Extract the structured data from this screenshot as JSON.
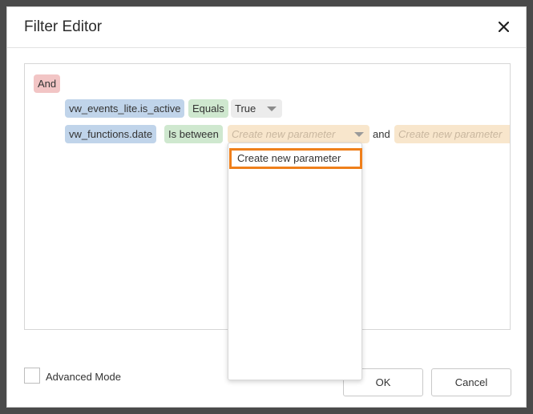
{
  "dialog": {
    "title": "Filter Editor",
    "close_icon": "close-icon"
  },
  "filter": {
    "group": "And",
    "conditions": [
      {
        "field": "vw_events_lite.is_active",
        "operator": "Equals",
        "value": "True"
      },
      {
        "field": "vw_functions.date",
        "operator": "Is between",
        "value1_placeholder": "Create new parameter",
        "connector": "and",
        "value2_placeholder": "Create new parameter"
      }
    ]
  },
  "dropdown": {
    "items": [
      "Create new parameter"
    ]
  },
  "footer": {
    "advanced_mode_label": "Advanced Mode",
    "ok_label": "OK",
    "cancel_label": "Cancel"
  },
  "colors": {
    "group": "#f2c5c5",
    "field": "#c0d4ea",
    "operator": "#cfe8cf",
    "value": "#ececec",
    "parameter": "#f8e6cc",
    "highlight": "#ef7f1a"
  }
}
